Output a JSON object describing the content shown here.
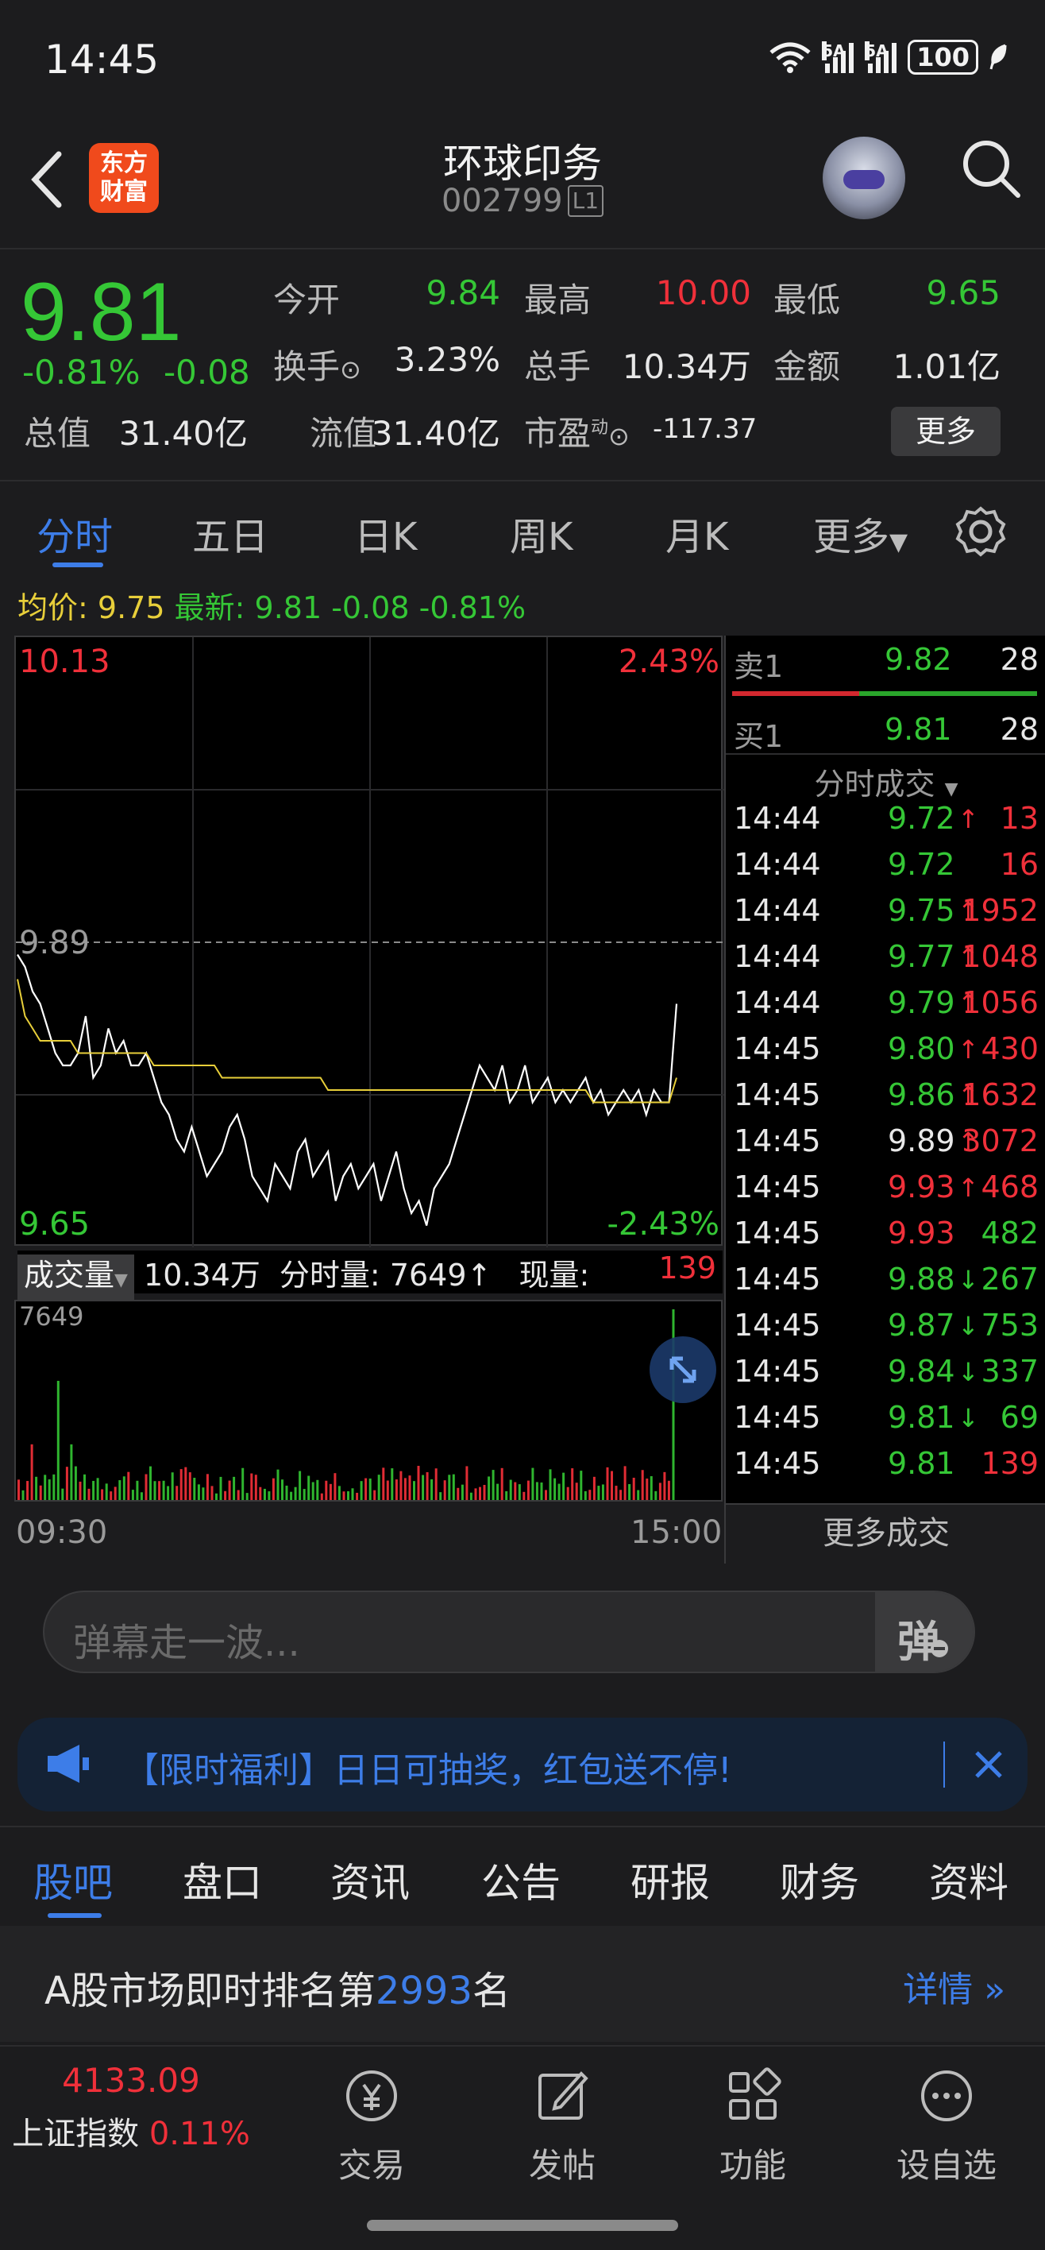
{
  "status_bar": {
    "time": "14:45",
    "net1": "5A",
    "net2": "5A",
    "battery": "100"
  },
  "header": {
    "logo_line1": "东方",
    "logo_line2": "财富",
    "name": "环球印务",
    "code": "002799",
    "level": "L1"
  },
  "quote": {
    "price": "9.81",
    "change_pct": "-0.81%",
    "change_amt": "-0.08",
    "open_label": "今开",
    "open": "9.84",
    "high_label": "最高",
    "high": "10.00",
    "low_label": "最低",
    "low": "9.65",
    "turnover_label": "换手",
    "turnover": "3.23%",
    "volume_label": "总手",
    "volume": "10.34万",
    "amount_label": "金额",
    "amount": "1.01亿",
    "mktcap_label": "总值",
    "mktcap": "31.40亿",
    "float_label": "流值",
    "float": "31.40亿",
    "pe_label": "市盈",
    "pe_sup": "动",
    "pe": "-117.37",
    "more": "更多"
  },
  "tabs": [
    "分时",
    "五日",
    "日K",
    "周K",
    "月K",
    "更多"
  ],
  "avg_line": {
    "avg_label": "均价:",
    "avg": "9.75",
    "last_label": "最新:",
    "last": "9.81",
    "chg": "-0.08",
    "pct": "-0.81%"
  },
  "chart": {
    "y_top": "10.13",
    "y_top_pct": "2.43%",
    "y_mid": "9.89",
    "y_bottom": "9.65",
    "y_bottom_pct": "-2.43%",
    "vol_label": "成交量",
    "vol_total": "10.34万",
    "tick_vol_label": "分时量:",
    "tick_vol": "7649",
    "cur_vol_label": "现量:",
    "cur_vol": "139",
    "vol_max": "7649",
    "time_start": "09:30",
    "time_end": "15:00"
  },
  "chart_data": {
    "type": "line",
    "title": "",
    "xlabel": "",
    "ylabel": "",
    "ylim": [
      9.65,
      10.13
    ],
    "series": [
      {
        "values": [
          9.88,
          9.87,
          9.85,
          9.84,
          9.82,
          9.8,
          9.79,
          9.79,
          9.8,
          9.83,
          9.78,
          9.79,
          9.82,
          9.8,
          9.81,
          9.79,
          9.79,
          9.8,
          9.78,
          9.76,
          9.75,
          9.73,
          9.72,
          9.74,
          9.72,
          9.7,
          9.71,
          9.72,
          9.74,
          9.75,
          9.73,
          9.7,
          9.69,
          9.68,
          9.71,
          9.7,
          9.69,
          9.72,
          9.73,
          9.7,
          9.71,
          9.72,
          9.68,
          9.7,
          9.71,
          9.69,
          9.7,
          9.71,
          9.68,
          9.7,
          9.72,
          9.69,
          9.67,
          9.68,
          9.66,
          9.69,
          9.7,
          9.71,
          9.73,
          9.75,
          9.77,
          9.79,
          9.78,
          9.77,
          9.79,
          9.76,
          9.77,
          9.79,
          9.76,
          9.77,
          9.78,
          9.76,
          9.77,
          9.76,
          9.77,
          9.78,
          9.76,
          9.77,
          9.75,
          9.76,
          9.77,
          9.76,
          9.77,
          9.75,
          9.77,
          9.76,
          9.76,
          9.84
        ]
      },
      {
        "values": [
          9.86,
          9.83,
          9.82,
          9.81,
          9.81,
          9.81,
          9.81,
          9.81,
          9.8,
          9.8,
          9.8,
          9.8,
          9.8,
          9.8,
          9.8,
          9.8,
          9.8,
          9.8,
          9.79,
          9.79,
          9.79,
          9.79,
          9.79,
          9.79,
          9.79,
          9.79,
          9.79,
          9.78,
          9.78,
          9.78,
          9.78,
          9.78,
          9.78,
          9.78,
          9.78,
          9.78,
          9.78,
          9.78,
          9.78,
          9.78,
          9.78,
          9.77,
          9.77,
          9.77,
          9.77,
          9.77,
          9.77,
          9.77,
          9.77,
          9.77,
          9.77,
          9.77,
          9.77,
          9.77,
          9.77,
          9.77,
          9.77,
          9.77,
          9.77,
          9.77,
          9.77,
          9.77,
          9.77,
          9.77,
          9.77,
          9.77,
          9.77,
          9.77,
          9.77,
          9.77,
          9.77,
          9.77,
          9.77,
          9.77,
          9.77,
          9.77,
          9.76,
          9.76,
          9.76,
          9.76,
          9.76,
          9.76,
          9.76,
          9.76,
          9.76,
          9.76,
          9.76,
          9.78
        ]
      }
    ]
  },
  "order_book": {
    "ask_label": "卖1",
    "ask_price": "9.82",
    "ask_vol": "28",
    "bid_label": "买1",
    "bid_price": "9.81",
    "bid_vol": "28",
    "ticks_title": "分时成交",
    "ticks": [
      {
        "t": "14:44",
        "p": "9.72",
        "d": "↑",
        "v": "13",
        "pc": "green",
        "vc": "red"
      },
      {
        "t": "14:44",
        "p": "9.72",
        "d": "",
        "v": "16",
        "pc": "green",
        "vc": "red"
      },
      {
        "t": "14:44",
        "p": "9.75",
        "d": "↑",
        "v": "1952",
        "pc": "green",
        "vc": "red"
      },
      {
        "t": "14:44",
        "p": "9.77",
        "d": "↑",
        "v": "1048",
        "pc": "green",
        "vc": "red"
      },
      {
        "t": "14:44",
        "p": "9.79",
        "d": "↑",
        "v": "1056",
        "pc": "green",
        "vc": "red"
      },
      {
        "t": "14:45",
        "p": "9.80",
        "d": "↑",
        "v": "430",
        "pc": "green",
        "vc": "red"
      },
      {
        "t": "14:45",
        "p": "9.86",
        "d": "↑",
        "v": "1632",
        "pc": "green",
        "vc": "red"
      },
      {
        "t": "14:45",
        "p": "9.89",
        "d": "↑",
        "v": "3072",
        "pc": "white",
        "vc": "red"
      },
      {
        "t": "14:45",
        "p": "9.93",
        "d": "↑",
        "v": "468",
        "pc": "red",
        "vc": "red"
      },
      {
        "t": "14:45",
        "p": "9.93",
        "d": "",
        "v": "482",
        "pc": "red",
        "vc": "green"
      },
      {
        "t": "14:45",
        "p": "9.88",
        "d": "↓",
        "v": "267",
        "pc": "green",
        "vc": "green"
      },
      {
        "t": "14:45",
        "p": "9.87",
        "d": "↓",
        "v": "753",
        "pc": "green",
        "vc": "green"
      },
      {
        "t": "14:45",
        "p": "9.84",
        "d": "↓",
        "v": "337",
        "pc": "green",
        "vc": "green"
      },
      {
        "t": "14:45",
        "p": "9.81",
        "d": "↓",
        "v": "69",
        "pc": "green",
        "vc": "green"
      },
      {
        "t": "14:45",
        "p": "9.81",
        "d": "",
        "v": "139",
        "pc": "green",
        "vc": "red"
      }
    ],
    "more_ticks": "更多成交"
  },
  "danmaku": {
    "placeholder": "弹幕走一波...",
    "button": "弹"
  },
  "promo": {
    "text": "【限时福利】日日可抽奖，红包送不停!"
  },
  "content_tabs": [
    "股吧",
    "盘口",
    "资讯",
    "公告",
    "研报",
    "财务",
    "资料"
  ],
  "rank": {
    "prefix": "A股市场即时排名第",
    "num": "2993",
    "suffix": "名",
    "detail": "详情"
  },
  "bottom_nav": {
    "index_value": "4133.09",
    "index_name": "上证指数",
    "index_pct": "0.11%",
    "trade": "交易",
    "post": "发帖",
    "func": "功能",
    "watch": "设自选"
  },
  "colors": {
    "up": "#f0303a",
    "down": "#35c736",
    "accent": "#3d7de8",
    "avg": "#e8cf3a"
  }
}
